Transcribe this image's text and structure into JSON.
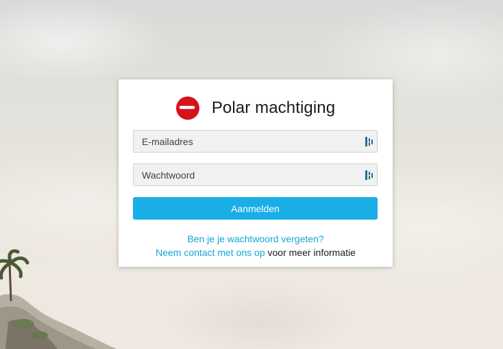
{
  "brand": {
    "title": "Polar machtiging",
    "logo_icon": "polar-logo-icon",
    "logo_color": "#d5121c"
  },
  "login_form": {
    "email": {
      "placeholder": "E-mailadres",
      "value": ""
    },
    "password": {
      "placeholder": "Wachtwoord",
      "value": ""
    },
    "password_manager_icon": "password-manager-icon",
    "submit_label": "Aanmelden"
  },
  "links": {
    "forgot_password": "Ben je je wachtwoord vergeten?",
    "contact": "Neem contact met ons op",
    "contact_suffix": " voor meer informatie"
  },
  "colors": {
    "accent": "#1aaee6",
    "link": "#14a3db",
    "card_background": "#ffffff",
    "field_background": "#f1f1f1"
  }
}
